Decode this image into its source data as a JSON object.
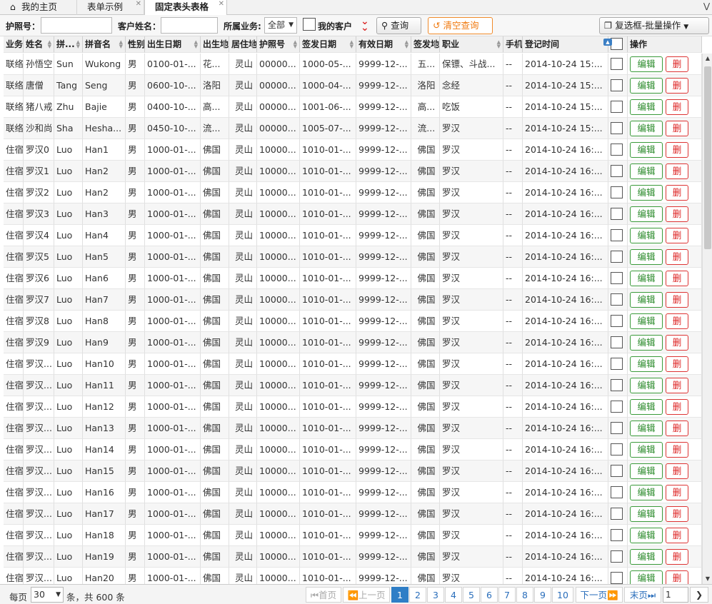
{
  "tabs": [
    {
      "label": "我的主页"
    },
    {
      "label": "表单示例"
    },
    {
      "label": "固定表头表格"
    }
  ],
  "toolbar": {
    "passport_label": "护照号：",
    "customer_label": "客户姓名：",
    "business_label": "所属业务:",
    "business_value": "全部",
    "my_customers_label": "我的客户",
    "query_label": "查询",
    "clear_label": "清空查询",
    "batch_label": "复选框-批量操作"
  },
  "columns": [
    "业务",
    "姓名",
    "拼...",
    "拼音名",
    "性别",
    "出生日期",
    "出生地",
    "居住地",
    "护照号",
    "签发日期",
    "有效日期",
    "签发地",
    "职业",
    "手机",
    "登记时间",
    "",
    "操作"
  ],
  "row_actions": {
    "edit": "编辑",
    "delete": "删"
  },
  "rows": [
    [
      "联络",
      "孙悟空",
      "Sun",
      "Wukong",
      "男",
      "0100-01-...",
      "花...",
      "灵山",
      "00000...",
      "1000-05-...",
      "9999-12-...",
      "五...",
      "保镖、斗战...",
      "--",
      "2014-10-24 15:..."
    ],
    [
      "联络",
      "唐僧",
      "Tang",
      "Seng",
      "男",
      "0600-10-...",
      "洛阳",
      "灵山",
      "00000...",
      "1000-04-...",
      "9999-12-...",
      "洛阳",
      "念经",
      "--",
      "2014-10-24 15:..."
    ],
    [
      "联络",
      "猪八戒",
      "Zhu",
      "Bajie",
      "男",
      "0400-10-...",
      "高...",
      "灵山",
      "00000...",
      "1001-06-...",
      "9999-12-...",
      "高...",
      "吃饭",
      "--",
      "2014-10-24 15:..."
    ],
    [
      "联络",
      "沙和尚",
      "Sha",
      "Hesha...",
      "男",
      "0450-10-...",
      "流...",
      "灵山",
      "00000...",
      "1005-07-...",
      "9999-12-...",
      "流...",
      "罗汉",
      "--",
      "2014-10-24 15:..."
    ],
    [
      "住宿",
      "罗汉0",
      "Luo",
      "Han1",
      "男",
      "1000-01-...",
      "佛国",
      "灵山",
      "10000...",
      "1010-01-...",
      "9999-12-...",
      "佛国",
      "罗汉",
      "--",
      "2014-10-24 16:..."
    ],
    [
      "住宿",
      "罗汉1",
      "Luo",
      "Han2",
      "男",
      "1000-01-...",
      "佛国",
      "灵山",
      "10000...",
      "1010-01-...",
      "9999-12-...",
      "佛国",
      "罗汉",
      "--",
      "2014-10-24 16:..."
    ],
    [
      "住宿",
      "罗汉2",
      "Luo",
      "Han2",
      "男",
      "1000-01-...",
      "佛国",
      "灵山",
      "10000...",
      "1010-01-...",
      "9999-12-...",
      "佛国",
      "罗汉",
      "--",
      "2014-10-24 16:..."
    ],
    [
      "住宿",
      "罗汉3",
      "Luo",
      "Han3",
      "男",
      "1000-01-...",
      "佛国",
      "灵山",
      "10000...",
      "1010-01-...",
      "9999-12-...",
      "佛国",
      "罗汉",
      "--",
      "2014-10-24 16:..."
    ],
    [
      "住宿",
      "罗汉4",
      "Luo",
      "Han4",
      "男",
      "1000-01-...",
      "佛国",
      "灵山",
      "10000...",
      "1010-01-...",
      "9999-12-...",
      "佛国",
      "罗汉",
      "--",
      "2014-10-24 16:..."
    ],
    [
      "住宿",
      "罗汉5",
      "Luo",
      "Han5",
      "男",
      "1000-01-...",
      "佛国",
      "灵山",
      "10000...",
      "1010-01-...",
      "9999-12-...",
      "佛国",
      "罗汉",
      "--",
      "2014-10-24 16:..."
    ],
    [
      "住宿",
      "罗汉6",
      "Luo",
      "Han6",
      "男",
      "1000-01-...",
      "佛国",
      "灵山",
      "10000...",
      "1010-01-...",
      "9999-12-...",
      "佛国",
      "罗汉",
      "--",
      "2014-10-24 16:..."
    ],
    [
      "住宿",
      "罗汉7",
      "Luo",
      "Han7",
      "男",
      "1000-01-...",
      "佛国",
      "灵山",
      "10000...",
      "1010-01-...",
      "9999-12-...",
      "佛国",
      "罗汉",
      "--",
      "2014-10-24 16:..."
    ],
    [
      "住宿",
      "罗汉8",
      "Luo",
      "Han8",
      "男",
      "1000-01-...",
      "佛国",
      "灵山",
      "10000...",
      "1010-01-...",
      "9999-12-...",
      "佛国",
      "罗汉",
      "--",
      "2014-10-24 16:..."
    ],
    [
      "住宿",
      "罗汉9",
      "Luo",
      "Han9",
      "男",
      "1000-01-...",
      "佛国",
      "灵山",
      "10000...",
      "1010-01-...",
      "9999-12-...",
      "佛国",
      "罗汉",
      "--",
      "2014-10-24 16:..."
    ],
    [
      "住宿",
      "罗汉...",
      "Luo",
      "Han10",
      "男",
      "1000-01-...",
      "佛国",
      "灵山",
      "10000...",
      "1010-01-...",
      "9999-12-...",
      "佛国",
      "罗汉",
      "--",
      "2014-10-24 16:..."
    ],
    [
      "住宿",
      "罗汉...",
      "Luo",
      "Han11",
      "男",
      "1000-01-...",
      "佛国",
      "灵山",
      "10000...",
      "1010-01-...",
      "9999-12-...",
      "佛国",
      "罗汉",
      "--",
      "2014-10-24 16:..."
    ],
    [
      "住宿",
      "罗汉...",
      "Luo",
      "Han12",
      "男",
      "1000-01-...",
      "佛国",
      "灵山",
      "10000...",
      "1010-01-...",
      "9999-12-...",
      "佛国",
      "罗汉",
      "--",
      "2014-10-24 16:..."
    ],
    [
      "住宿",
      "罗汉...",
      "Luo",
      "Han13",
      "男",
      "1000-01-...",
      "佛国",
      "灵山",
      "10000...",
      "1010-01-...",
      "9999-12-...",
      "佛国",
      "罗汉",
      "--",
      "2014-10-24 16:..."
    ],
    [
      "住宿",
      "罗汉...",
      "Luo",
      "Han14",
      "男",
      "1000-01-...",
      "佛国",
      "灵山",
      "10000...",
      "1010-01-...",
      "9999-12-...",
      "佛国",
      "罗汉",
      "--",
      "2014-10-24 16:..."
    ],
    [
      "住宿",
      "罗汉...",
      "Luo",
      "Han15",
      "男",
      "1000-01-...",
      "佛国",
      "灵山",
      "10000...",
      "1010-01-...",
      "9999-12-...",
      "佛国",
      "罗汉",
      "--",
      "2014-10-24 16:..."
    ],
    [
      "住宿",
      "罗汉...",
      "Luo",
      "Han16",
      "男",
      "1000-01-...",
      "佛国",
      "灵山",
      "10000...",
      "1010-01-...",
      "9999-12-...",
      "佛国",
      "罗汉",
      "--",
      "2014-10-24 16:..."
    ],
    [
      "住宿",
      "罗汉...",
      "Luo",
      "Han17",
      "男",
      "1000-01-...",
      "佛国",
      "灵山",
      "10000...",
      "1010-01-...",
      "9999-12-...",
      "佛国",
      "罗汉",
      "--",
      "2014-10-24 16:..."
    ],
    [
      "住宿",
      "罗汉...",
      "Luo",
      "Han18",
      "男",
      "1000-01-...",
      "佛国",
      "灵山",
      "10000...",
      "1010-01-...",
      "9999-12-...",
      "佛国",
      "罗汉",
      "--",
      "2014-10-24 16:..."
    ],
    [
      "住宿",
      "罗汉...",
      "Luo",
      "Han19",
      "男",
      "1000-01-...",
      "佛国",
      "灵山",
      "10000...",
      "1010-01-...",
      "9999-12-...",
      "佛国",
      "罗汉",
      "--",
      "2014-10-24 16:..."
    ],
    [
      "住宿",
      "罗汉...",
      "Luo",
      "Han20",
      "男",
      "1000-01-...",
      "佛国",
      "灵山",
      "10000...",
      "1010-01-...",
      "9999-12-...",
      "佛国",
      "罗汉",
      "--",
      "2014-10-24 16:..."
    ]
  ],
  "pager": {
    "per_page_label": "每页",
    "per_page_value": "30",
    "total_label": "条，共 600 条",
    "first": "首页",
    "prev": "上一页",
    "pages": [
      "1",
      "2",
      "3",
      "4",
      "5",
      "6",
      "7",
      "8",
      "9",
      "10"
    ],
    "current_page": "1",
    "next": "下一页",
    "last": "末页",
    "jump_value": "1"
  },
  "colors": {
    "accent": "#2f7ec6",
    "edit": "#2a8a2a",
    "delete": "#d22222",
    "clear": "#f07a10"
  }
}
